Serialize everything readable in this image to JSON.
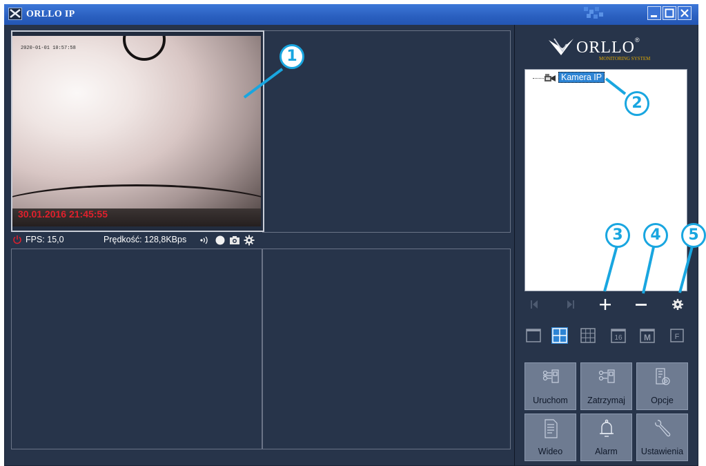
{
  "window": {
    "title": "ORLLO IP",
    "minimize_icon": "minimize-icon",
    "maximize_icon": "maximize-icon",
    "close_icon": "close-icon"
  },
  "video": {
    "osd_top": "2020-01-01  10:57:58",
    "osd_timestamp": "30.01.2016 21:45:55",
    "fps": "FPS: 15,0",
    "speed": "Prędkość: 128,8KBps",
    "status_icons": [
      "audio-icon",
      "record-icon",
      "snapshot-icon",
      "settings-icon"
    ]
  },
  "logo": {
    "name": "ORLLO",
    "reg": "®",
    "subtitle": "MONITORING SYSTEM"
  },
  "device_tree": {
    "items": [
      {
        "label": "Kamera IP",
        "selected": true
      }
    ]
  },
  "controls": [
    "prev-icon",
    "next-icon",
    "add-icon",
    "remove-icon",
    "gear-icon"
  ],
  "view_layouts": [
    "1",
    "4",
    "9",
    "16",
    "M",
    "F"
  ],
  "buttons": {
    "start": "Uruchom",
    "stop": "Zatrzymaj",
    "options": "Opcje",
    "video": "Wideo",
    "alarm": "Alarm",
    "settings": "Ustawienia"
  },
  "callouts": [
    "1",
    "2",
    "3",
    "4",
    "5"
  ],
  "colors": {
    "title_bar": "#2a5fbf",
    "background": "#27344a",
    "accent": "#19a6e0",
    "osd_red": "#e0202c",
    "button": "#6e7b91",
    "view_active": "#2d84d4"
  }
}
